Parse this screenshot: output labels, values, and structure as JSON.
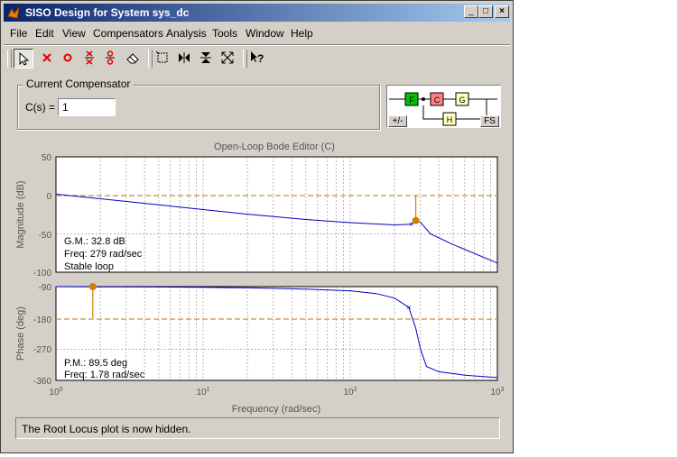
{
  "window": {
    "title": "SISO Design for System sys_dc",
    "controls": {
      "minimize": "_",
      "maximize": "□",
      "close": "×"
    }
  },
  "menu": [
    "File",
    "Edit",
    "View",
    "Compensators",
    "Analysis",
    "Tools",
    "Window",
    "Help"
  ],
  "toolbar": {
    "icons": [
      "pointer-icon",
      "add-pole-icon",
      "add-zero-icon",
      "add-complex-pole-icon",
      "add-complex-zero-icon",
      "eraser-icon",
      "zoom-xy-icon",
      "zoom-x-icon",
      "zoom-y-icon",
      "fit-icon",
      "context-help-icon"
    ]
  },
  "compensator": {
    "legend": "Current Compensator",
    "label": "C(s) =",
    "value": "1"
  },
  "block_diagram": {
    "blocks": [
      "F",
      "C",
      "G",
      "H"
    ],
    "sign_button": "+/-",
    "fs_button": "FS",
    "colors": {
      "F": "#00c000",
      "C": "#ff8080",
      "G": "#ffffc0",
      "H": "#ffffc0"
    }
  },
  "bode": {
    "title": "Open-Loop Bode Editor (C)",
    "magnitude_ylabel": "Magnitude (dB)",
    "phase_ylabel": "Phase (deg)",
    "xlabel": "Frequency (rad/sec)",
    "magnitude_ticks": [
      "50",
      "0",
      "-50",
      "-100"
    ],
    "phase_ticks": [
      "-90",
      "-180",
      "-270",
      "-360"
    ],
    "x_ticks": [
      {
        "base": "10",
        "exp": "0"
      },
      {
        "base": "10",
        "exp": "1"
      },
      {
        "base": "10",
        "exp": "2"
      },
      {
        "base": "10",
        "exp": "3"
      }
    ],
    "gain_margin_text": [
      "G.M.: 32.8 dB",
      "Freq: 279 rad/sec",
      "Stable loop"
    ],
    "phase_margin_text": [
      "P.M.: 89.5 deg",
      "Freq: 1.78 rad/sec"
    ]
  },
  "chart_data": {
    "type": "line",
    "title": "Open-Loop Bode Editor (C)",
    "xlabel": "Frequency (rad/sec)",
    "x_scale": "log",
    "xlim": [
      1,
      1000
    ],
    "grid": true,
    "series": [
      {
        "axis": "magnitude",
        "ylim": [
          -100,
          50
        ],
        "x": [
          1,
          2,
          5,
          10,
          20,
          50,
          100,
          200,
          260,
          279,
          300,
          350,
          500,
          1000
        ],
        "y": [
          1.5,
          -4.5,
          -12.5,
          -18.5,
          -24.5,
          -31.5,
          -35.5,
          -38.5,
          -37.5,
          -32.8,
          -35,
          -50,
          -64,
          -88
        ]
      },
      {
        "axis": "phase",
        "ylim": [
          -360,
          -90
        ],
        "x": [
          1,
          2,
          5,
          10,
          20,
          50,
          100,
          150,
          200,
          250,
          279,
          300,
          330,
          400,
          600,
          1000
        ],
        "y": [
          -90,
          -90.5,
          -91,
          -92,
          -93.5,
          -97,
          -102,
          -110,
          -123,
          -150,
          -210,
          -270,
          -320,
          -335,
          -345,
          -352
        ]
      }
    ],
    "gain_margin": {
      "value_db": 32.8,
      "freq": 279
    },
    "phase_margin": {
      "value_deg": 89.5,
      "freq": 1.78
    },
    "colors": {
      "curve": "#0000c8",
      "margin": "#d08000",
      "reference": "#c89040"
    }
  },
  "status": "The Root Locus plot is now hidden."
}
